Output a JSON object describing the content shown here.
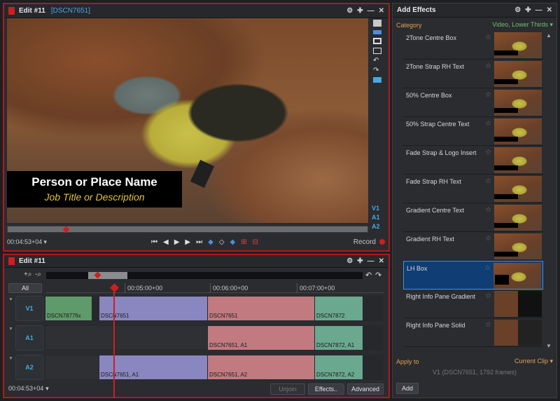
{
  "viewer": {
    "title": "Edit #11",
    "subtitle": "[DSCN7651]",
    "overlay_name": "Person or Place Name",
    "overlay_job": "Job Title or Description",
    "track_tags": [
      "V1",
      "A1",
      "A2"
    ],
    "timecode": "00:04:53+04",
    "record_label": "Record",
    "transport_icons": [
      "go-start-icon",
      "step-back-icon",
      "play-icon",
      "step-forward-icon",
      "go-end-icon"
    ],
    "scrub_position": 0.16
  },
  "effects": {
    "title": "Add Effects",
    "category_label": "Category",
    "category_value": "Video, Lower Thirds",
    "items": [
      {
        "label": "2Tone Centre Box",
        "selected": false
      },
      {
        "label": "2Tone Strap RH Text",
        "selected": false
      },
      {
        "label": "50% Centre Box",
        "selected": false
      },
      {
        "label": "50% Strap Centre Text",
        "selected": false
      },
      {
        "label": "Fade Strap & Logo Insert",
        "selected": false
      },
      {
        "label": "Fade Strap RH Text",
        "selected": false
      },
      {
        "label": "Gradient Centre Text",
        "selected": false
      },
      {
        "label": "Gradient RH Text",
        "selected": false
      },
      {
        "label": "LH Box",
        "selected": true
      },
      {
        "label": "Right Info Pane Gradient",
        "selected": false
      },
      {
        "label": "Right Info Pane Solid",
        "selected": false
      }
    ],
    "apply_to_label": "Apply to",
    "apply_to_value": "Current Clip",
    "info": "V1 (DSCN7651, 1792 frames)",
    "add_button": "Add"
  },
  "timeline": {
    "title": "Edit #11",
    "all_label": "All",
    "ruler": [
      "00:05:00+00",
      "00:06:00+00",
      "00:07:00+00"
    ],
    "tracks": [
      {
        "label": "V1",
        "clips": [
          {
            "name": "DSCN7877fix",
            "color": "#5f9a6a"
          },
          {
            "name": "DSCN7651",
            "color": "#8a86c0"
          },
          {
            "name": "DSCN7651",
            "color": "#c07a80"
          },
          {
            "name": "DSCN7872",
            "color": "#6aa890"
          }
        ]
      },
      {
        "label": "A1",
        "clips": [
          {
            "name": "",
            "color": "dark"
          },
          {
            "name": "DSCN7651, A1",
            "color": "#c07a80"
          },
          {
            "name": "DSCN7872, A1",
            "color": "#6aa890"
          }
        ]
      },
      {
        "label": "A2",
        "clips": [
          {
            "name": "",
            "color": "dark"
          },
          {
            "name": "DSCN7651, A1",
            "color": "#8a86c0"
          },
          {
            "name": "DSCN7651, A2",
            "color": "#c07a80"
          },
          {
            "name": "DSCN7872, A2",
            "color": "#6aa890"
          }
        ]
      }
    ],
    "timecode": "00:04:53+04",
    "unjoin_button": "Unjoin",
    "effects_button": "Effects..",
    "advanced_button": "Advanced"
  }
}
